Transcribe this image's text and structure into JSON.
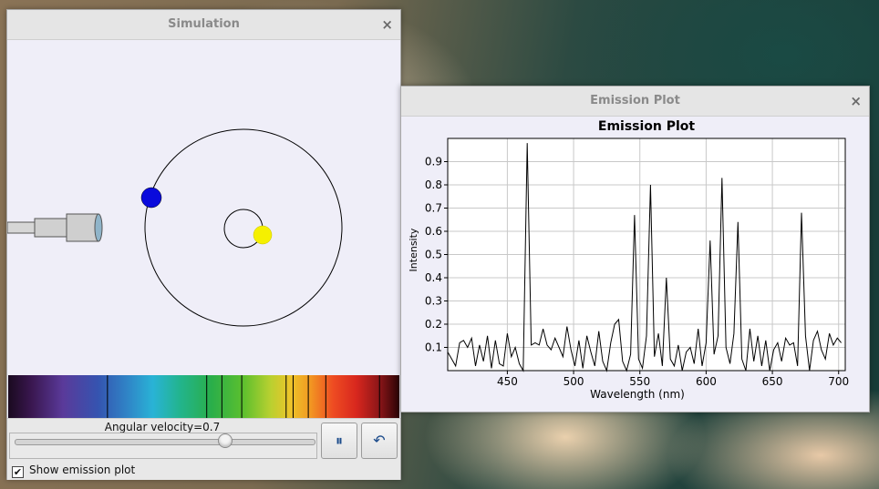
{
  "sim_window": {
    "title": "Simulation",
    "close_glyph": "×",
    "velocity_label": "Angular velocity=0.7",
    "slider": {
      "value": 0.7,
      "min": 0,
      "max": 1
    },
    "pause_icon": "pause-icon",
    "pause_glyph": "⏸",
    "reset_icon": "reset-icon",
    "reset_glyph": "↶",
    "checkbox_label": "Show emission plot",
    "checkbox_checked": true,
    "checkbox_glyph": "✔",
    "spectrum_lines_nm": [
      465,
      550,
      563,
      580,
      618,
      624,
      637,
      652,
      698
    ]
  },
  "plot_window": {
    "title": "Emission Plot",
    "close_glyph": "×"
  },
  "chart_data": {
    "type": "line",
    "title": "Emission Plot",
    "xlabel": "Wavelength (nm)",
    "ylabel": "Intensity",
    "xlim": [
      405,
      705
    ],
    "ylim": [
      0,
      1.0
    ],
    "xticks": [
      450,
      500,
      550,
      600,
      650,
      700
    ],
    "yticks": [
      0.1,
      0.2,
      0.3,
      0.4,
      0.5,
      0.6,
      0.7,
      0.8,
      0.9
    ],
    "grid": true,
    "series": [
      {
        "color": "#000000",
        "x": [
          405,
          408,
          411,
          414,
          417,
          420,
          423,
          426,
          429,
          432,
          435,
          438,
          441,
          444,
          447,
          450,
          453,
          456,
          459,
          462,
          465,
          468,
          471,
          474,
          477,
          480,
          483,
          486,
          489,
          492,
          495,
          498,
          501,
          504,
          507,
          510,
          513,
          516,
          519,
          522,
          525,
          528,
          531,
          534,
          537,
          540,
          543,
          546,
          549,
          552,
          555,
          558,
          561,
          564,
          567,
          570,
          573,
          576,
          579,
          582,
          585,
          588,
          591,
          594,
          597,
          600,
          603,
          606,
          609,
          612,
          615,
          618,
          621,
          624,
          627,
          630,
          633,
          636,
          639,
          642,
          645,
          648,
          651,
          654,
          657,
          660,
          663,
          666,
          669,
          672,
          675,
          678,
          681,
          684,
          687,
          690,
          693,
          696,
          699,
          702
        ],
        "y": [
          0.08,
          0.05,
          0.02,
          0.12,
          0.13,
          0.1,
          0.14,
          0.02,
          0.11,
          0.04,
          0.15,
          0.01,
          0.13,
          0.03,
          0.02,
          0.16,
          0.06,
          0.1,
          0.03,
          0.0,
          0.98,
          0.11,
          0.12,
          0.11,
          0.18,
          0.11,
          0.09,
          0.14,
          0.1,
          0.06,
          0.19,
          0.09,
          0.02,
          0.13,
          0.01,
          0.15,
          0.08,
          0.02,
          0.17,
          0.04,
          0.0,
          0.12,
          0.2,
          0.22,
          0.04,
          0.0,
          0.07,
          0.67,
          0.05,
          0.01,
          0.15,
          0.8,
          0.06,
          0.16,
          0.02,
          0.4,
          0.05,
          0.02,
          0.11,
          0.0,
          0.08,
          0.1,
          0.03,
          0.18,
          0.02,
          0.12,
          0.56,
          0.07,
          0.15,
          0.83,
          0.1,
          0.03,
          0.16,
          0.64,
          0.05,
          0.0,
          0.18,
          0.04,
          0.15,
          0.02,
          0.13,
          0.0,
          0.09,
          0.12,
          0.04,
          0.14,
          0.11,
          0.12,
          0.02,
          0.68,
          0.15,
          0.0,
          0.13,
          0.17,
          0.09,
          0.05,
          0.16,
          0.11,
          0.14,
          0.12
        ]
      }
    ]
  }
}
